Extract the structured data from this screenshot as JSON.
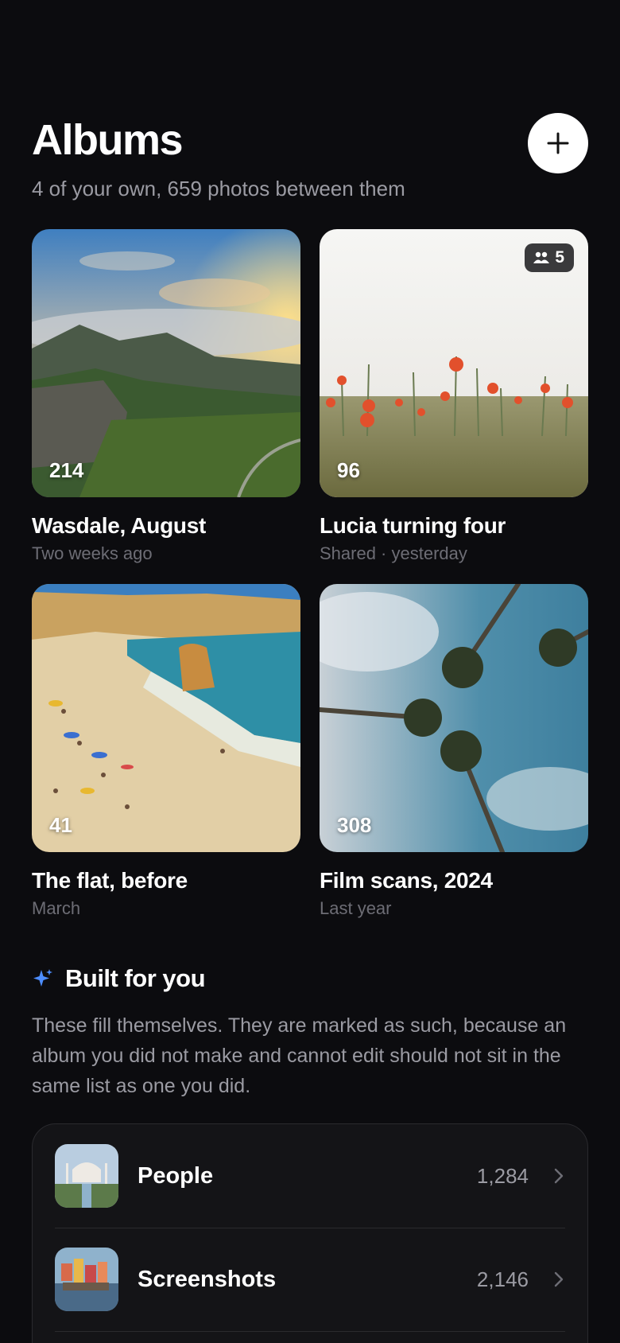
{
  "header": {
    "title": "Albums",
    "subtitle": "4 of your own, 659 photos between them"
  },
  "albums": [
    {
      "title": "Wasdale, August",
      "subtitle": "Two weeks ago",
      "count": "214"
    },
    {
      "title": "Lucia turning four",
      "subtitle": "Shared · yesterday",
      "count": "96",
      "shared_count": "5"
    },
    {
      "title": "The flat, before",
      "subtitle": "March",
      "count": "41"
    },
    {
      "title": "Film scans, 2024",
      "subtitle": "Last year",
      "count": "308"
    }
  ],
  "built_for_you": {
    "title": "Built for you",
    "description": "These fill themselves. They are marked as such, because an album you did not make and cannot edit should not sit in the same list as one you did.",
    "items": [
      {
        "label": "People",
        "count": "1,284"
      },
      {
        "label": "Screenshots",
        "count": "2,146"
      }
    ]
  },
  "colors": {
    "background": "#0c0c0f",
    "accent": "#4d8dff",
    "muted": "#9b9ba3"
  },
  "icons": {
    "add": "plus-icon",
    "sparkle": "sparkle-icon",
    "shared": "people-icon",
    "chevron": "chevron-right-icon"
  }
}
